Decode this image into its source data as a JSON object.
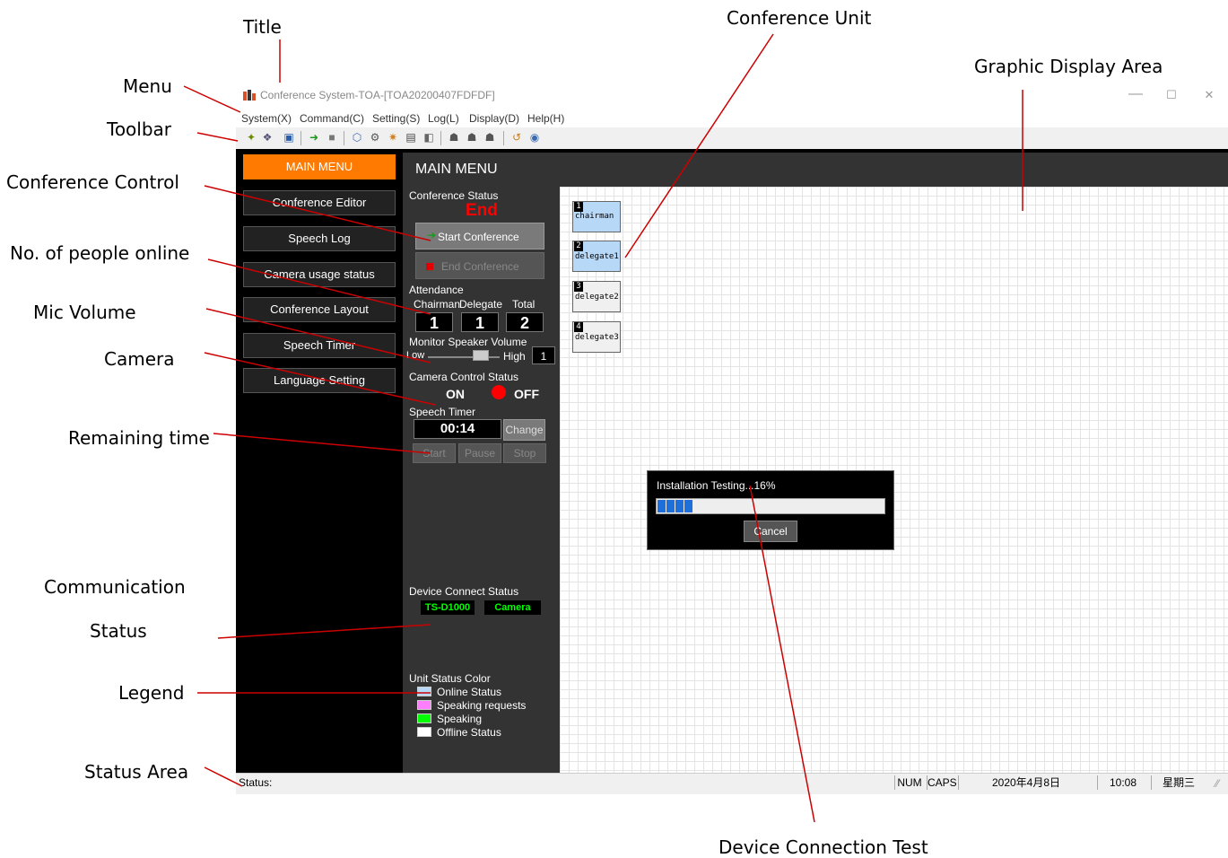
{
  "callouts": {
    "title": "Title",
    "menu": "Menu",
    "toolbar": "Toolbar",
    "conference_control": "Conference Control",
    "people_online": "No. of people online",
    "mic_volume": "Mic Volume",
    "camera": "Camera",
    "remaining_time": "Remaining time",
    "communication": "Communication",
    "status": "Status",
    "legend": "Legend",
    "status_area": "Status Area",
    "conference_unit": "Conference Unit",
    "graphic_display_area": "Graphic Display Area",
    "device_connection_test": "Device Connection Test"
  },
  "window": {
    "title": "Conference System-TOA-[TOA20200407FDFDF]",
    "controls": {
      "minimize": "—",
      "maximize": "☐",
      "close": "✕"
    }
  },
  "menu": [
    "System(X)",
    "Command(C)",
    "Setting(S)",
    "Log(L)",
    "Display(D)",
    "Help(H)"
  ],
  "sidebar": {
    "items": [
      {
        "label": "MAIN MENU"
      },
      {
        "label": "Conference Editor"
      },
      {
        "label": "Speech Log"
      },
      {
        "label": "Camera usage status"
      },
      {
        "label": "Conference Layout"
      },
      {
        "label": "Speech Timer"
      },
      {
        "label": "Language  Setting"
      }
    ]
  },
  "header": {
    "title": "MAIN MENU"
  },
  "control": {
    "conference_status_label": "Conference Status",
    "conference_status_value": "End",
    "start_conference": "Start Conference",
    "end_conference": "End Conference",
    "attendance_label": "Attendance",
    "chairman_label": "Chairman",
    "delegate_label": "Delegate",
    "total_label": "Total",
    "chairman_count": "1",
    "delegate_count": "1",
    "total_count": "2",
    "monitor_volume_label": "Monitor Speaker Volume",
    "low_label": "Low",
    "high_label": "High",
    "volume_value": "1",
    "camera_status_label": "Camera Control Status",
    "camera_on": "ON",
    "camera_off": "OFF",
    "speech_timer_label": "Speech Timer",
    "timer_value": "00:14",
    "change_button": "Change",
    "start_button": "Start",
    "pause_button": "Pause",
    "stop_button": "Stop",
    "device_connect_label": "Device Connect Status",
    "device_1": "TS-D1000",
    "device_2": "Camera",
    "legend_label": "Unit Status Color",
    "legend": [
      {
        "label": "Online Status",
        "color": "#b8d8f8"
      },
      {
        "label": "Speaking requests",
        "color": "#ff80ff"
      },
      {
        "label": "Speaking",
        "color": "#00ff00"
      },
      {
        "label": "Offline Status",
        "color": "#ffffff"
      }
    ]
  },
  "units": [
    {
      "num": "1",
      "name": "chairman",
      "color": "#b8d8f8"
    },
    {
      "num": "2",
      "name": "delegate1",
      "color": "#b8d8f8"
    },
    {
      "num": "3",
      "name": "delegate2",
      "color": "#f0f0f0"
    },
    {
      "num": "4",
      "name": "delegate3",
      "color": "#f0f0f0"
    }
  ],
  "dialog": {
    "text": "Installation Testing...16%",
    "progress": 0.16,
    "cancel": "Cancel"
  },
  "statusbar": {
    "status": "Status:",
    "num": "NUM",
    "caps": "CAPS",
    "date": "2020年4月8日",
    "time": "10:08",
    "weekday": "星期三"
  },
  "colors": {
    "accent": "#ff7a00",
    "end_red": "#ff0000",
    "device_green": "#00ff00"
  }
}
